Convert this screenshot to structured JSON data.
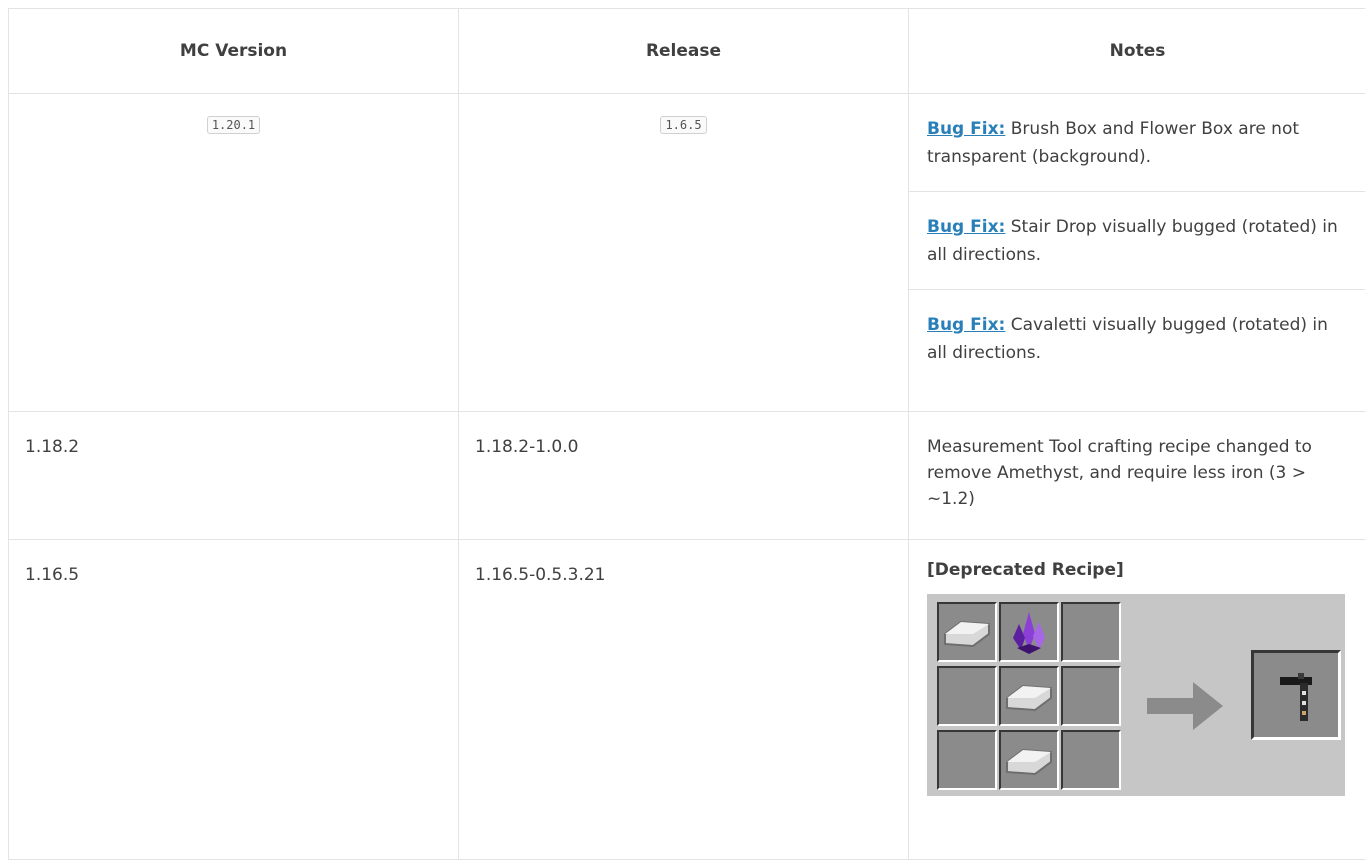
{
  "table": {
    "headers": [
      "MC Version",
      "Release",
      "Notes"
    ],
    "rows": [
      {
        "mc_version": "1.20.1",
        "release": "1.6.5",
        "notes": [
          {
            "tag": "Bug Fix:",
            "text": " Brush Box and Flower Box are not transparent (background)."
          },
          {
            "tag": "Bug Fix:",
            "text": " Stair Drop visually bugged (rotated) in all directions."
          },
          {
            "tag": "Bug Fix:",
            "text": " Cavaletti visually bugged (rotated) in all directions."
          }
        ]
      },
      {
        "mc_version": "1.18.2",
        "release": "1.18.2-1.0.0",
        "note": "Measurement Tool crafting recipe changed to remove Amethyst, and require less iron (3 > ~1.2)"
      },
      {
        "mc_version": "1.16.5",
        "release": "1.16.5-0.5.3.21",
        "note_title": "[Deprecated Recipe]",
        "recipe": {
          "grid": [
            "iron-ingot-icon",
            "amethyst-shard-icon",
            "",
            "",
            "iron-ingot-icon",
            "",
            "",
            "iron-ingot-icon",
            ""
          ],
          "output": "measurement-tool-icon"
        }
      }
    ]
  },
  "colors": {
    "link": "#2980b9",
    "text": "#404040",
    "border": "#e1e4e5",
    "recipe_bg": "#c6c6c6",
    "slot_bg": "#8b8b8b"
  }
}
